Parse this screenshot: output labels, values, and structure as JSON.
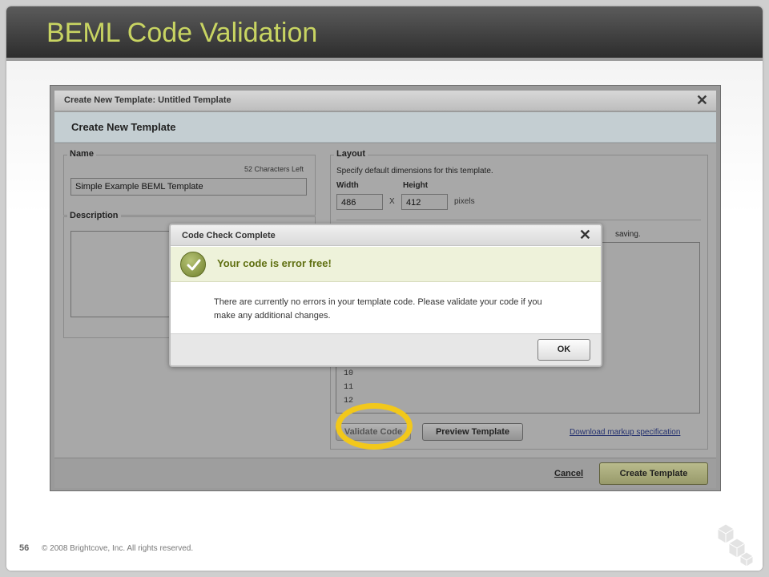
{
  "slide": {
    "title": "BEML Code Validation",
    "page_number": "56",
    "copyright": "© 2008 Brightcove, Inc. All rights reserved."
  },
  "window": {
    "title": "Create New Template: Untitled Template",
    "close_glyph": "✕",
    "form_header": "Create New Template"
  },
  "name_section": {
    "legend": "Name",
    "chars_left": "52 Characters Left",
    "value": "Simple Example BEML Template"
  },
  "description_section": {
    "legend": "Description"
  },
  "layout_section": {
    "legend": "Layout",
    "description": "Specify default dimensions for this template.",
    "width_label": "Width",
    "height_label": "Height",
    "width_value": "486",
    "height_value": "412",
    "times": "X",
    "units": "pixels",
    "partial_text": "saving.",
    "line_numbers": [
      "10",
      "11",
      "12"
    ],
    "validate_button": "Validate Code",
    "preview_button": "Preview Template",
    "download_link": "Download markup specification"
  },
  "footer": {
    "cancel": "Cancel",
    "create_button": "Create Template"
  },
  "dialog": {
    "title": "Code Check Complete",
    "close_glyph": "✕",
    "success_message": "Your code is error free!",
    "body": "There are currently no errors in your template code. Please validate your code if you make any additional changes.",
    "ok_button": "OK"
  },
  "colors": {
    "title_accent": "#c8d462",
    "highlight_ring": "#f2c81b",
    "success_text": "#5f6f10"
  },
  "icons": {
    "logo": "brightcove-cubes-logo",
    "check": "check-circle-icon"
  }
}
